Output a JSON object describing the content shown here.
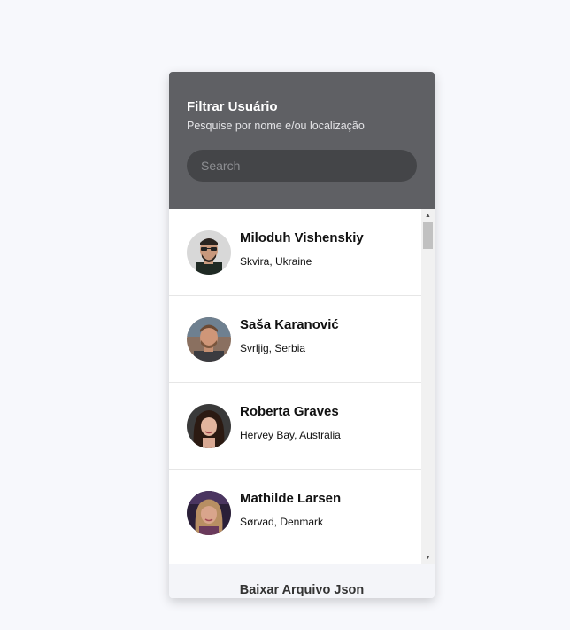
{
  "header": {
    "title": "Filtrar Usuário",
    "subtitle": "Pesquise por nome e/ou localização"
  },
  "search": {
    "placeholder": "Search",
    "value": ""
  },
  "users": [
    {
      "name": "Miloduh Vishenskiy",
      "location": "Skvira, Ukraine"
    },
    {
      "name": "Saša Karanović",
      "location": "Svrljig, Serbia"
    },
    {
      "name": "Roberta Graves",
      "location": "Hervey Bay, Australia"
    },
    {
      "name": "Mathilde Larsen",
      "location": "Sørvad, Denmark"
    }
  ],
  "scrollbar": {
    "up_icon": "triangle-up",
    "down_icon": "triangle-down"
  },
  "footer": {
    "button_label": "Baixar Arquivo Json"
  }
}
